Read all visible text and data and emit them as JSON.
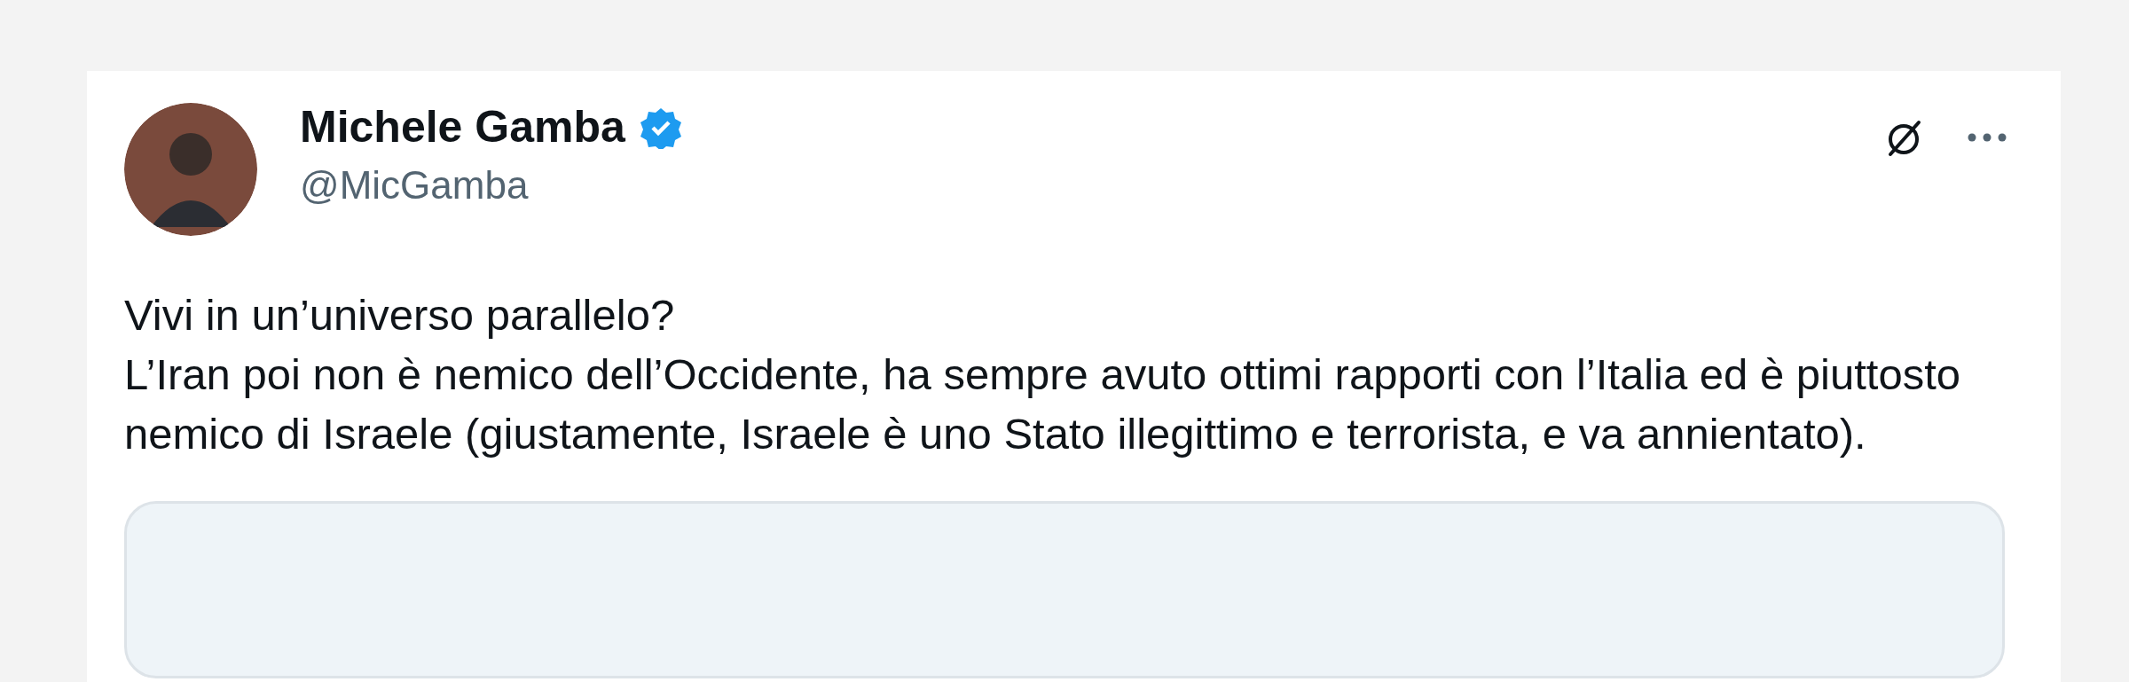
{
  "author": {
    "name": "Michele Gamba",
    "verified": true,
    "handle": "@MicGamba"
  },
  "post": {
    "lines": [
      "Vivi in un’universo parallelo?",
      "L’Iran poi non è nemico dell’Occidente, ha sempre avuto ottimi rapporti con l’Italia ed è piuttosto nemico di Israele (giustamente, Israele è uno Stato illegittimo e terrorista, e va annientato)."
    ]
  },
  "quoted_post": {
    "kind": "card"
  }
}
